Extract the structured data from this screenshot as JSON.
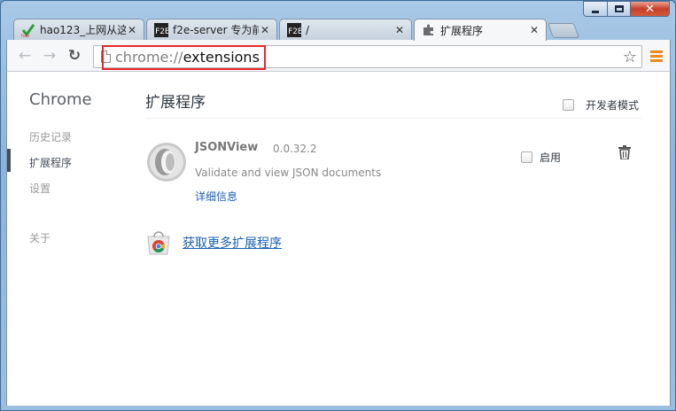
{
  "window": {
    "controls": {
      "minimize": "minimize",
      "maximize": "maximize",
      "close": "✕"
    }
  },
  "tabs": [
    {
      "title": "hao123_上网从这",
      "favicon": "hao123-icon",
      "active": false
    },
    {
      "title": "f2e-server 专为前",
      "favicon": "f2e-icon",
      "active": false
    },
    {
      "title": "/",
      "favicon": "f2e-icon",
      "active": false
    },
    {
      "title": "扩展程序",
      "favicon": "puzzle-icon",
      "active": true
    }
  ],
  "toolbar": {
    "url_scheme": "chrome://",
    "url_host": "extensions"
  },
  "sidebar": {
    "brand": "Chrome",
    "items": [
      {
        "label": "历史记录",
        "selected": false
      },
      {
        "label": "扩展程序",
        "selected": true
      },
      {
        "label": "设置",
        "selected": false
      },
      {
        "label": "关于",
        "selected": false
      }
    ]
  },
  "main": {
    "title": "扩展程序",
    "devmode_label": "开发者模式",
    "extensions": [
      {
        "name": "JSONView",
        "version": "0.0.32.2",
        "description": "Validate and view JSON documents",
        "details_link": "详细信息",
        "enable_label": "启用"
      }
    ],
    "gallery_link": "获取更多扩展程序"
  },
  "colors": {
    "accent_red_highlight": "#e8262a",
    "link_blue": "#1a5fb4",
    "menu_orange": "#f08a1c"
  }
}
